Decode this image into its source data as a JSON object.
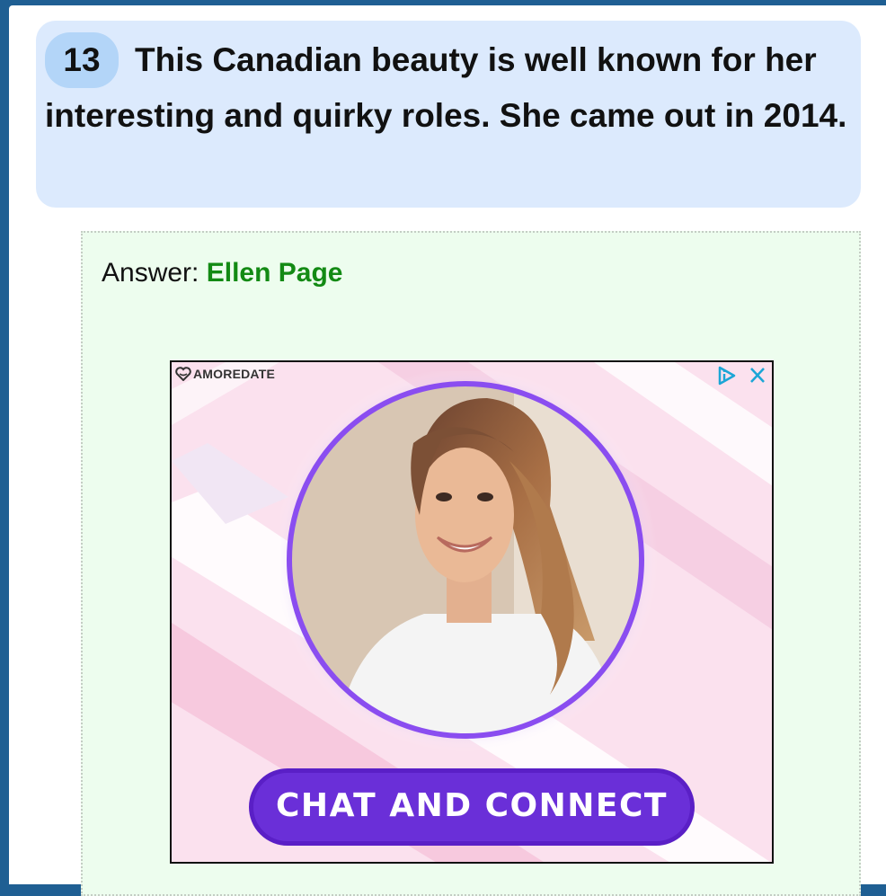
{
  "question": {
    "number": "13",
    "text": "This Canadian beauty is well known for her interesting and quirky roles. She came out in 2014."
  },
  "answer": {
    "label": "Answer: ",
    "value": "Ellen Page"
  },
  "ad": {
    "brand": "AMOREDATE",
    "cta_label": "CHAT AND CONNECT",
    "colors": {
      "accent_purple": "#6a2fd8",
      "background_pink": "#fbe1ee",
      "adchoices_blue": "#1ba6d6"
    }
  }
}
